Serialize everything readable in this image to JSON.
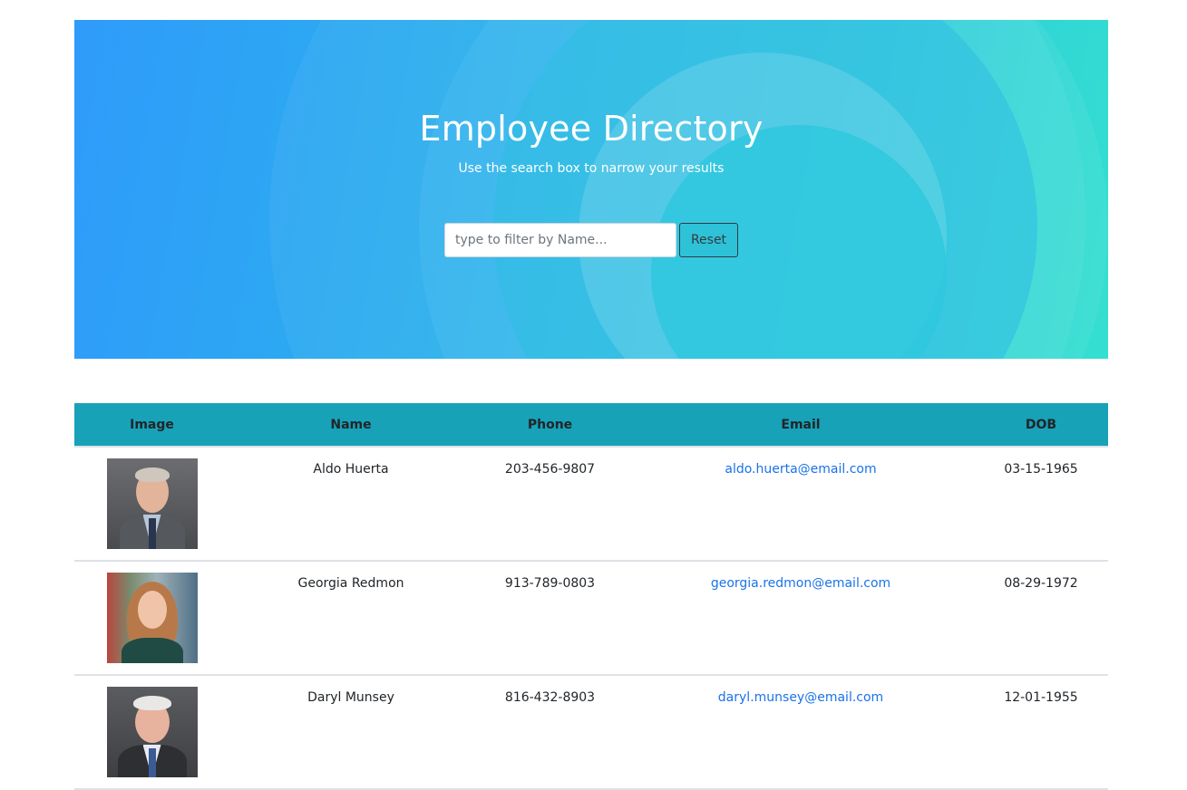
{
  "header": {
    "title": "Employee Directory",
    "subtitle": "Use the search box to narrow your results",
    "search_placeholder": "type to filter by Name...",
    "search_value": "",
    "reset_label": "Reset"
  },
  "table": {
    "columns": [
      "Image",
      "Name",
      "Phone",
      "Email",
      "DOB"
    ],
    "rows": [
      {
        "name": "Aldo Huerta",
        "phone": "203-456-9807",
        "email": "aldo.huerta@email.com",
        "dob": "03-15-1965",
        "avatar": "man-gray-suit-photo"
      },
      {
        "name": "Georgia Redmon",
        "phone": "913-789-0803",
        "email": "georgia.redmon@email.com",
        "dob": "08-29-1972",
        "avatar": "woman-long-hair-photo"
      },
      {
        "name": "Daryl Munsey",
        "phone": "816-432-8903",
        "email": "daryl.munsey@email.com",
        "dob": "12-01-1955",
        "avatar": "man-white-hair-photo"
      }
    ]
  },
  "colors": {
    "hero_gradient_start": "#2f9bfb",
    "hero_gradient_end": "#34dfd0",
    "table_header": "#17a2b8",
    "link": "#1a73e8"
  }
}
